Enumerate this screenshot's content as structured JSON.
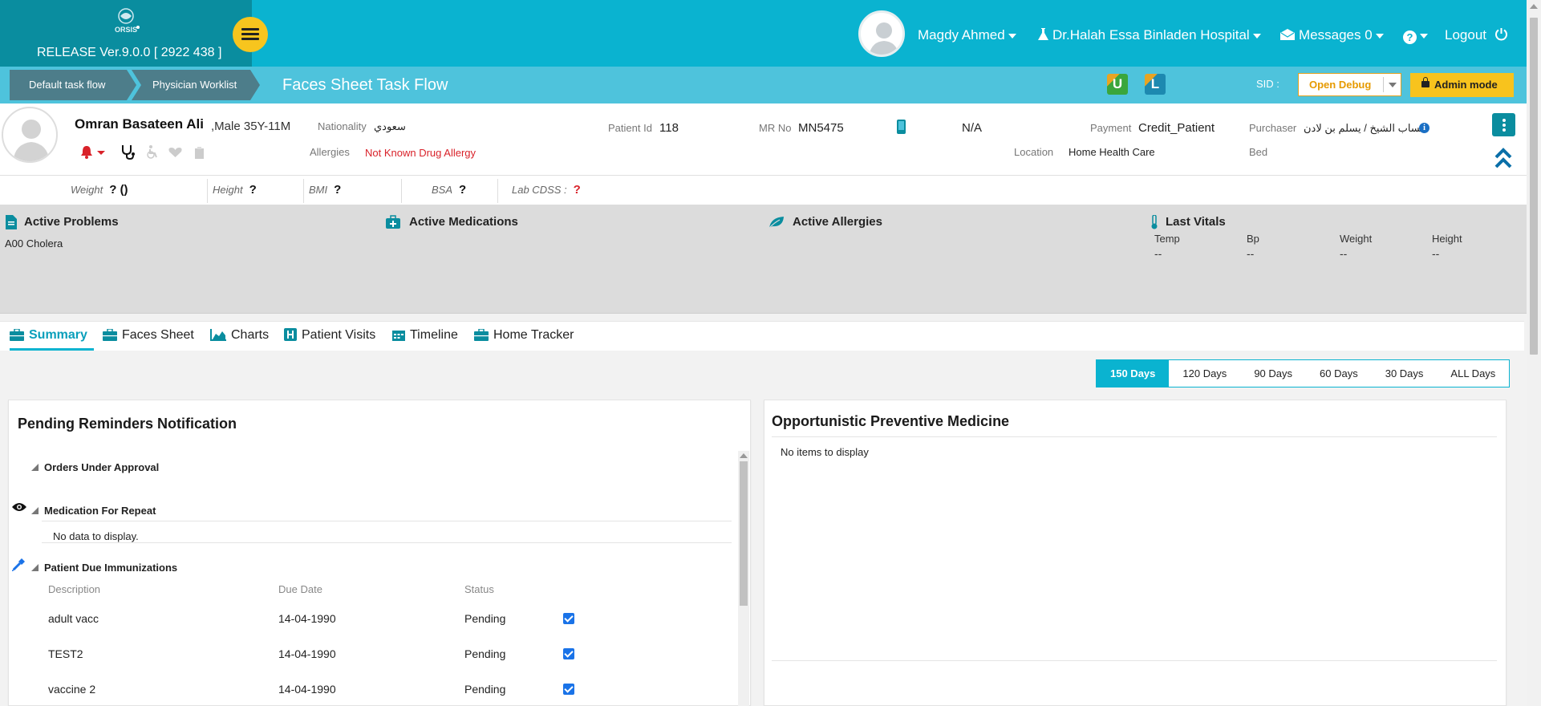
{
  "brand": {
    "logo_text": "ORSIS",
    "release": "RELEASE Ver.9.0.0 [ 2922 438 ]"
  },
  "topbar": {
    "user": "Magdy Ahmed",
    "hospital": "Dr.Halah Essa Binladen Hospital",
    "messages": "Messages 0",
    "help": "?",
    "logout": "Logout"
  },
  "breadcrumb": {
    "items": [
      "Default task flow",
      "Physician Worklist"
    ]
  },
  "page_title": "Faces Sheet Task Flow",
  "subbar": {
    "u_label": "U",
    "l_label": "L",
    "sid_label": "SID :",
    "debug_value": "Open Debug",
    "admin_label": "Admin mode"
  },
  "patient": {
    "name": "Omran Basateen Ali",
    "gender_age": ",Male 35Y-11M",
    "nationality_label": "Nationality",
    "nationality": "سعودي",
    "allergies_label": "Allergies",
    "allergies": "Not Known Drug Allergy",
    "patient_id_label": "Patient Id",
    "patient_id": "118",
    "mr_label": "MR No",
    "mr_no": "MN5475",
    "phone": "N/A",
    "payment_label": "Payment",
    "payment": "Credit_Patient",
    "location_label": "Location",
    "location": "Home Health Care",
    "purchaser_label": "Purchaser",
    "purchaser": "حساب الشيخ / يسلم بن لادن",
    "bed_label": "Bed"
  },
  "metrics": [
    {
      "label": "Weight",
      "value": "? ()"
    },
    {
      "label": "Height",
      "value": "?"
    },
    {
      "label": "BMI",
      "value": "?"
    },
    {
      "label": "BSA",
      "value": "?"
    },
    {
      "label": "Lab CDSS :",
      "value": "?"
    }
  ],
  "active": {
    "problems_title": "Active Problems",
    "problems": [
      "A00 Cholera"
    ],
    "medications_title": "Active Medications",
    "allergies_title": "Active Allergies",
    "vitals_title": "Last Vitals",
    "vitals": [
      {
        "label": "Temp",
        "value": "--"
      },
      {
        "label": "Bp",
        "value": "--"
      },
      {
        "label": "Weight",
        "value": "--"
      },
      {
        "label": "Height",
        "value": "--"
      }
    ]
  },
  "tabs": [
    "Summary",
    "Faces Sheet",
    "Charts",
    "Patient Visits",
    "Timeline",
    "Home Tracker"
  ],
  "days_filter": {
    "options": [
      "150 Days",
      "120 Days",
      "90 Days",
      "60 Days",
      "30 Days",
      "ALL Days"
    ],
    "selected": "150 Days"
  },
  "reminders": {
    "title": "Pending Reminders Notification",
    "orders_title": "Orders Under Approval",
    "med_repeat_title": "Medication For Repeat",
    "no_data": "No data to display.",
    "immunizations_title": "Patient Due Immunizations",
    "columns": [
      "Description",
      "Due Date",
      "Status"
    ],
    "rows": [
      {
        "description": "adult vacc",
        "due_date": "14-04-1990",
        "status": "Pending"
      },
      {
        "description": "TEST2",
        "due_date": "14-04-1990",
        "status": "Pending"
      },
      {
        "description": "vaccine 2",
        "due_date": "14-04-1990",
        "status": "Pending"
      }
    ]
  },
  "preventive": {
    "title": "Opportunistic Preventive Medicine",
    "empty": "No items to display"
  },
  "colors": {
    "topbar": "#0ab3d0",
    "brand": "#0a8d9f",
    "accent_yellow": "#f8c31d",
    "red": "#d9222a"
  }
}
